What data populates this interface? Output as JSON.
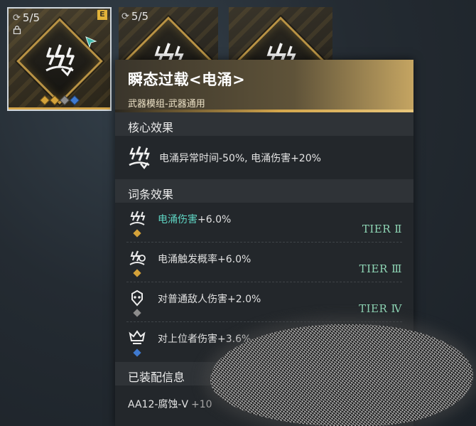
{
  "modules": [
    {
      "count": "5/5",
      "grade": "E",
      "locked": true,
      "selected": true,
      "gems": [
        "#d4a23a",
        "#d4a23a",
        "#8d8d8d",
        "#3f7ad0"
      ]
    },
    {
      "count": "5/5",
      "selected": false
    },
    {
      "count": "",
      "selected": false
    }
  ],
  "tooltip": {
    "title": "瞬态过载<电涌>",
    "subtitle": "武器模组-武器通用",
    "core_section": "核心效果",
    "core_effect": "电涌异常时间-50%, 电涌伤害+20%",
    "affix_section": "词条效果",
    "affixes": [
      {
        "highlight": "电涌伤害",
        "rest": "+6.0%",
        "tier": "TIER Ⅱ",
        "gem": "#d4a23a",
        "icon": "surge-damage-icon"
      },
      {
        "highlight": "",
        "rest": "电涌触发概率+6.0%",
        "tier": "TIER Ⅲ",
        "gem": "#d4a23a",
        "icon": "surge-trigger-icon"
      },
      {
        "highlight": "",
        "rest": "对普通敌人伤害+2.0%",
        "tier": "TIER Ⅳ",
        "gem": "#8d8d8d",
        "icon": "normal-enemy-icon"
      },
      {
        "highlight": "",
        "rest": "对上位者伤害+3.6%",
        "tier": "",
        "gem": "#3f7ad0",
        "icon": "elite-enemy-icon"
      }
    ],
    "equip_section": "已装配信息",
    "equip_weapon": "AA12-腐蚀-Ⅴ",
    "equip_level": "+10"
  },
  "colors": {
    "accent_gold": "#d6a64a",
    "highlight_teal": "#5fd6c4",
    "tier_green": "#8fd6b5"
  }
}
